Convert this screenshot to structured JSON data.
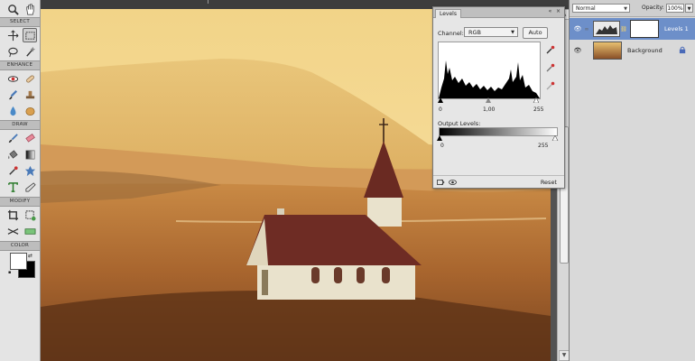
{
  "toolbox": {
    "sections": {
      "select": "SELECT",
      "enhance": "ENHANCE",
      "draw": "DRAW",
      "modify": "MODIFY",
      "color": "COLOR"
    }
  },
  "layers_panel": {
    "blend_mode": "Normal",
    "opacity_label": "Opacity:",
    "opacity_value": "100%",
    "layers": [
      {
        "name": "Levels 1",
        "active": true
      },
      {
        "name": "Background",
        "active": false
      }
    ]
  },
  "levels_dialog": {
    "tab_label": "Levels",
    "channel_label": "Channel:",
    "channel_value": "RGB",
    "auto_label": "Auto",
    "input_black": "0",
    "input_gamma": "1,00",
    "input_white": "255",
    "output_label": "Output Levels:",
    "output_black": "0",
    "output_white": "255",
    "reset_label": "Reset"
  },
  "colors": {
    "toolbox_bg": "#e4e4e4",
    "panel_bg": "#d9d9d9",
    "active_layer": "#6d8fc9",
    "workspace": "#535353"
  }
}
